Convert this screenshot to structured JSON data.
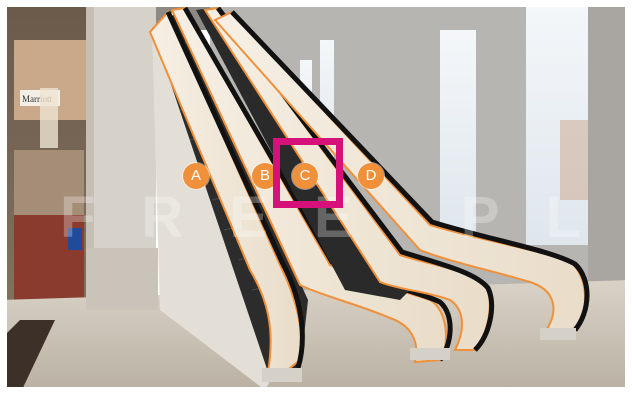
{
  "image": {
    "description_hidden": true,
    "markers": [
      {
        "label": "A"
      },
      {
        "label": "B"
      },
      {
        "label": "C"
      },
      {
        "label": "D"
      }
    ],
    "highlight": {
      "target_label": "C",
      "color": "#d6127a"
    },
    "marker_color": "#f0903a",
    "watermark_text": "FREE PLAN",
    "sign_text": "Marriott"
  }
}
